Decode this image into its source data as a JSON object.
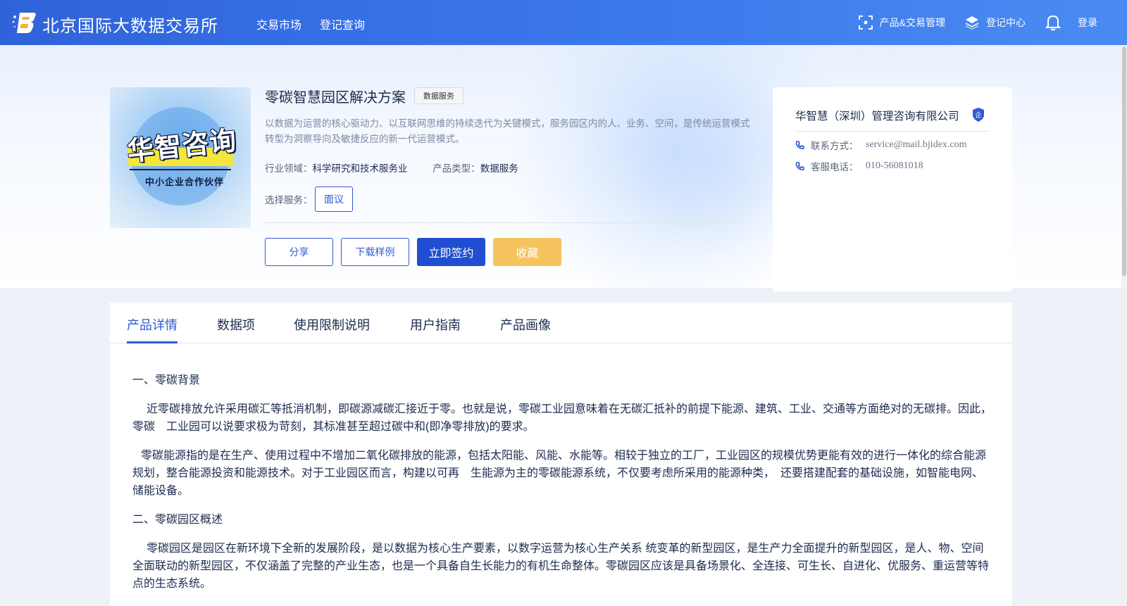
{
  "header": {
    "brand": "北京国际大数据交易所",
    "nav": [
      "交易市场",
      "登记查询"
    ],
    "product_mgmt": "产品&交易管理",
    "register_center": "登记中心",
    "login": "登录"
  },
  "product": {
    "image_title": "华智咨询",
    "image_subtitle": "中小企业合作伙伴",
    "title": "零碳智慧园区解决方案",
    "tag": "数据服务",
    "description": "以数据为运营的核心驱动力、以互联网思维的持续迭代为关键模式，服务园区内的人、业务、空间，是传统运营模式转型为洞察导向及敏捷反应的新一代运营模式。",
    "industry_label": "行业领域：",
    "industry_value": "科学研究和技术服务业",
    "type_label": "产品类型：",
    "type_value": "数据服务",
    "service_label": "选择服务：",
    "service_option": "面议",
    "buttons": {
      "share": "分享",
      "download": "下载样例",
      "sign": "立即签约",
      "favorite": "收藏"
    }
  },
  "company": {
    "name": "华智慧（深圳）管理咨询有限公司",
    "badge": "企",
    "contact_label": "联系方式：",
    "contact_value": "service@mail.bjidex.com",
    "phone_label": "客服电话：",
    "phone_value": "010-56081018"
  },
  "tabs": [
    "产品详情",
    "数据项",
    "使用限制说明",
    "用户指南",
    "产品画像"
  ],
  "active_tab": 0,
  "content": {
    "h1": "一、零碳背景",
    "p1": "近零碳排放允许采用碳汇等抵消机制，即碳源减碳汇接近于零。也就是说，零碳工业园意味着在无碳汇抵补的前提下能源、建筑、工业、交通等方面绝对的无碳排。因此，零碳　工业园可以说要求极为苛刻，其标准甚至超过碳中和(即净零排放)的要求。",
    "p2": "零碳能源指的是在生产、使用过程中不增加二氧化碳排放的能源，包括太阳能、风能、水能等。相较于独立的工厂，工业园区的规模优势更能有效的进行一体化的综合能源规划，整合能源投资和能源技术。对于工业园区而言，构建以可再　生能源为主的零碳能源系统，不仅要考虑所采用的能源种类，　还要搭建配套的基础设施，如智能电网、储能设备。",
    "h2": "二、零碳园区概述",
    "p3": "零碳园区是园区在新环境下全新的发展阶段，是以数据为核心生产要素，以数字运营为核心生产关系 统变革的新型园区，是生产力全面提升的新型园区，是人、物、空间全面联动的新型园区，不仅涵盖了完整的产业生态，也是一个具备自生长能力的有机生命整体。零碳园区应该是具备场景化、全连接、可生长、自进化、优服务、重运营等特点的生态系统。"
  }
}
